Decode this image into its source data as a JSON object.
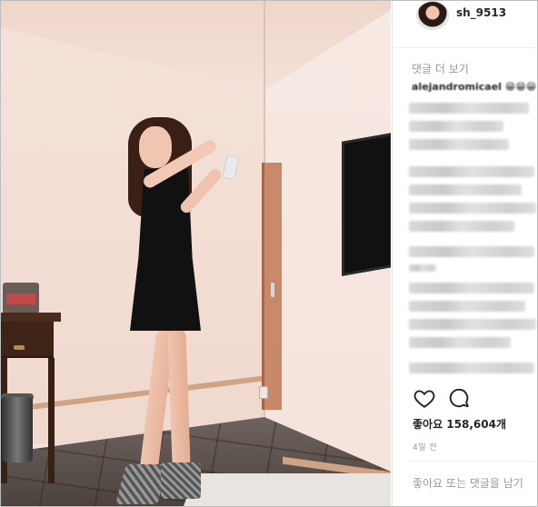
{
  "post": {
    "username": "sh_9513",
    "more_comments_label": "댓글 더 보기",
    "visible_comment_user": "alejandromicael 😁😁😁",
    "likes_label": "좋아요 158,604개",
    "time_label": "4일 전",
    "add_comment_placeholder": "좋아요 또는 댓글을 남기",
    "icons": [
      "heart-icon",
      "comment-icon"
    ]
  },
  "colors": {
    "text_primary": "#262626",
    "text_secondary": "#999999",
    "divider": "#efefef"
  }
}
